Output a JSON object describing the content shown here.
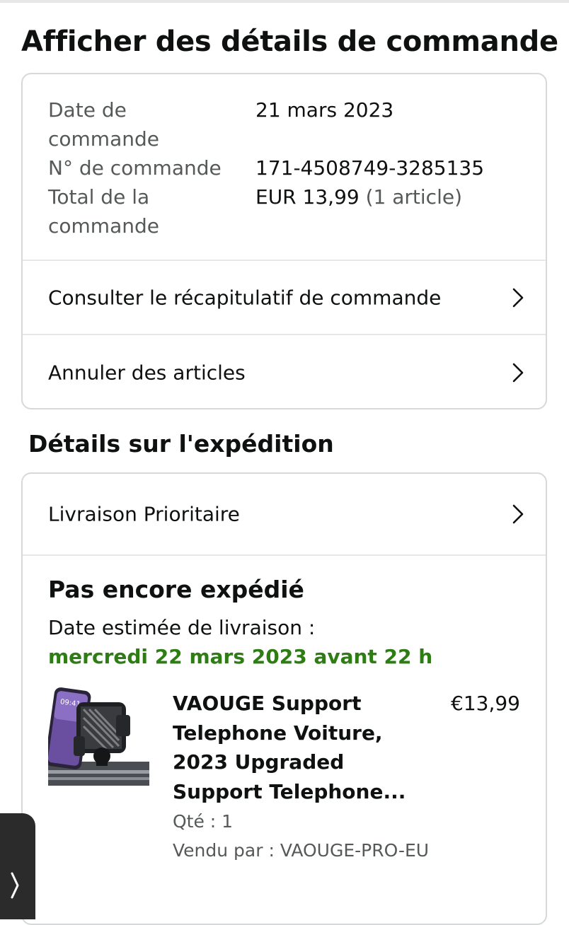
{
  "page": {
    "title": "Afficher des détails de commande"
  },
  "order": {
    "date_label": "Date de commande",
    "date_value": "21 mars 2023",
    "number_label": "N° de commande",
    "number_value": "171-4508749-3285135",
    "total_label": "Total de la commande",
    "total_value": "EUR 13,99",
    "total_count": "(1 article)"
  },
  "links": {
    "summary": "Consulter le récapitulatif de commande",
    "cancel": "Annuler des articles"
  },
  "shipment": {
    "section_title": "Détails sur l'expédition",
    "delivery_option": "Livraison Prioritaire",
    "status": "Pas encore expédié",
    "eta_label": "Date estimée de livraison :",
    "eta_date": "mercredi 22 mars 2023 avant 22 h"
  },
  "product": {
    "title": "VAOUGE Support Telephone Voiture, 2023 Upgraded Support Telephone...",
    "price": "€13,99",
    "qty": "Qté : 1",
    "seller": "Vendu par : VAOUGE-PRO-EU",
    "image_time": "09:41"
  },
  "colors": {
    "eta_green": "#2e7d14",
    "muted_text": "#565959",
    "border": "#d5d9d9"
  },
  "icons": {
    "row_chevron": "chevron-right-icon",
    "side_tab": "chevron-right-icon"
  }
}
